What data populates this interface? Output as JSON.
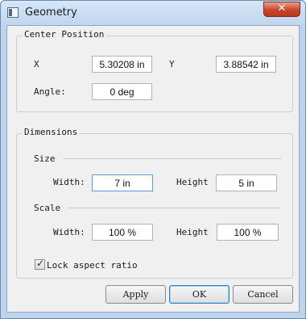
{
  "window": {
    "title": "Geometry",
    "close_label": "✕"
  },
  "center_position": {
    "title": "Center Position",
    "x_label": "X",
    "x_value": "5.30208 in",
    "y_label": "Y",
    "y_value": "3.88542 in",
    "angle_label": "Angle:",
    "angle_value": "0 deg"
  },
  "dimensions": {
    "title": "Dimensions",
    "size": {
      "label": "Size",
      "width_label": "Width:",
      "width_value": "7 in",
      "height_label": "Height",
      "height_value": "5 in"
    },
    "scale": {
      "label": "Scale",
      "width_label": "Width:",
      "width_value": "100 %",
      "height_label": "Height",
      "height_value": "100 %"
    },
    "lock_aspect_label": "Lock aspect ratio",
    "lock_aspect_checked": true
  },
  "buttons": {
    "apply": "Apply",
    "ok": "OK",
    "cancel": "Cancel"
  }
}
